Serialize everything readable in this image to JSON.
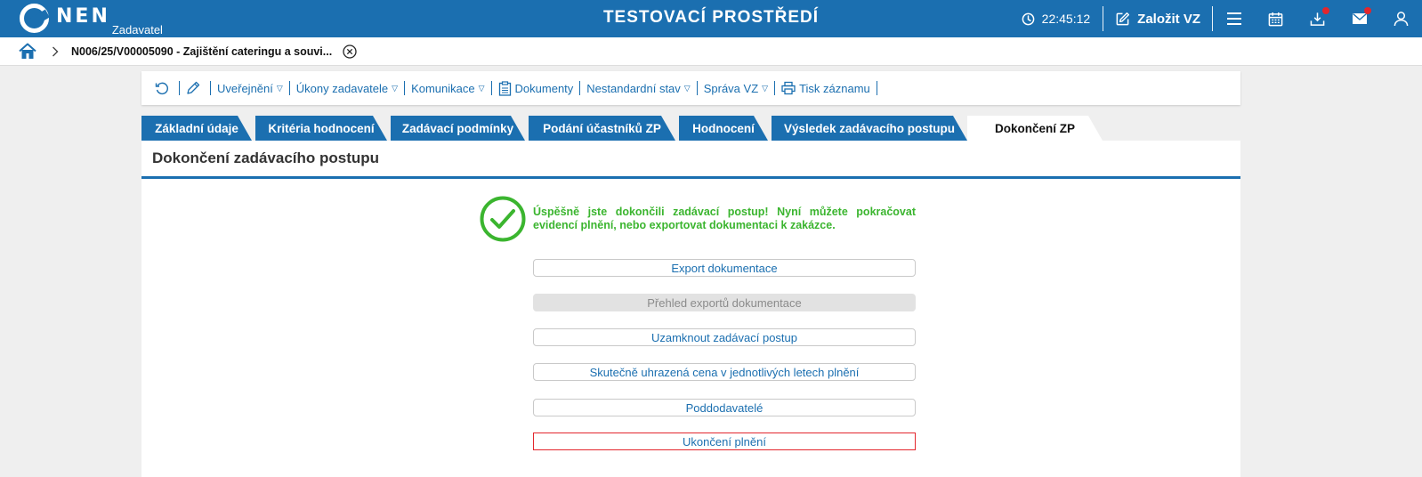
{
  "header": {
    "logo_text": "NEN",
    "logo_sub": "Zadavatel",
    "env_title": "TESTOVACÍ PROSTŘEDÍ",
    "clock": "22:45:12",
    "create_label": "Založit VZ",
    "icons": [
      "menu-icon",
      "calendar-icon",
      "download-icon",
      "mail-icon",
      "user-icon"
    ],
    "accent": "#1b6fb0",
    "alert_color": "#e3262d"
  },
  "breadcrumb": {
    "item": "N006/25/V00005090 - Zajištění cateringu a souvi..."
  },
  "toolbar": {
    "publish": "Uveřejnění",
    "actions": "Úkony zadavatele",
    "communication": "Komunikace",
    "documents": "Dokumenty",
    "nonstandard": "Nestandardní stav",
    "admin": "Správa VZ",
    "print": "Tisk záznamu"
  },
  "tabs": [
    {
      "label": "Základní údaje"
    },
    {
      "label": "Kritéria hodnocení"
    },
    {
      "label": "Zadávací podmínky"
    },
    {
      "label": "Podání účastníků ZP"
    },
    {
      "label": "Hodnocení"
    },
    {
      "label": "Výsledek zadávacího postupu"
    },
    {
      "label": "Dokončení ZP"
    }
  ],
  "panel": {
    "title": "Dokončení zadávacího postupu",
    "success_message": "Úspěšně jste dokončili zadávací postup! Nyní můžete pokračovat evidencí plnění, nebo exportovat dokumentaci k zakázce.",
    "success_color": "#3bb52f",
    "buttons": [
      {
        "label": "Export dokumentace"
      },
      {
        "label": "Přehled exportů dokumentace"
      },
      {
        "label": "Uzamknout zadávací postup"
      },
      {
        "label": "Skutečně uhrazená cena v jednotlivých letech plnění"
      },
      {
        "label": "Poddodavatelé"
      },
      {
        "label": "Ukončení plnění"
      }
    ]
  }
}
